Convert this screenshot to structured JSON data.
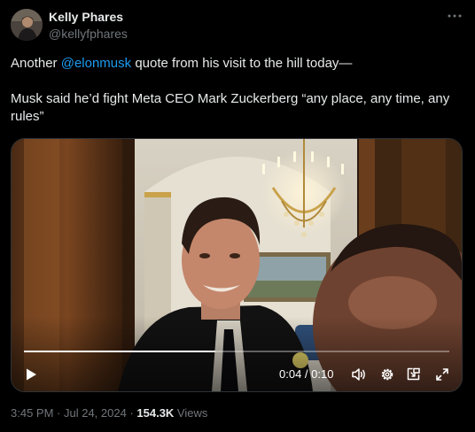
{
  "author": {
    "name": "Kelly Phares",
    "handle": "@kellyfphares"
  },
  "tweet": {
    "line1_prefix": "Another ",
    "mention": "@elonmusk",
    "line1_suffix": " quote from his visit to the hill today—",
    "paragraph2": "Musk said he’d fight Meta CEO Mark Zuckerberg “any place, any time, any rules”"
  },
  "video": {
    "time_display": "0:04 / 0:10",
    "progress_fraction": 0.45,
    "icons": [
      "play-icon",
      "volume-icon",
      "settings-icon",
      "picture-in-picture-icon",
      "fullscreen-icon"
    ]
  },
  "meta": {
    "time": "3:45 PM",
    "sep1": " · ",
    "date": "Jul 24, 2024",
    "sep2": " · ",
    "views_count": "154.3K",
    "views_label": " Views"
  },
  "colors": {
    "background": "#000000",
    "text": "#e7e9ea",
    "secondary": "#71767b",
    "link": "#1d9bf0"
  }
}
